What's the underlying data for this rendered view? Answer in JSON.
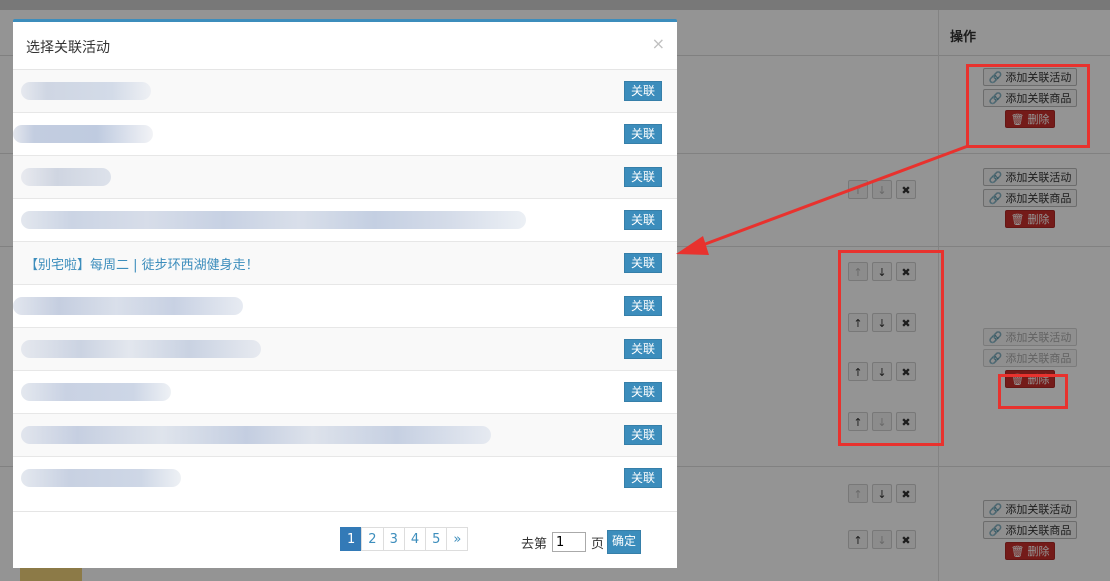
{
  "background": {
    "header": {
      "operation_label": "操作"
    },
    "rows": [
      {
        "actions": {
          "add_activity": "添加关联活动",
          "add_goods": "添加关联商品",
          "delete": "删除"
        }
      },
      {
        "actions": {
          "add_activity": "添加关联活动",
          "add_goods": "添加关联商品",
          "delete": "删除"
        }
      },
      {
        "actions": {
          "add_activity": "添加关联活动",
          "add_goods": "添加关联商品",
          "delete": "删除"
        }
      },
      {
        "actions": {
          "add_activity": "添加关联活动",
          "add_goods": "添加关联商品",
          "delete": "删除"
        }
      }
    ],
    "move_icons": {
      "up": "↑",
      "down": "↓",
      "remove": "✖"
    }
  },
  "modal": {
    "title": "选择关联活动",
    "close_icon": "×",
    "items": [
      {
        "text": "",
        "blurred": true,
        "button": "关联"
      },
      {
        "text": "",
        "blurred": true,
        "button": "关联"
      },
      {
        "text": "",
        "blurred": true,
        "button": "关联"
      },
      {
        "text": "",
        "blurred": true,
        "button": "关联"
      },
      {
        "text": "【别宅啦】每周二 | 徒步环西湖健身走！",
        "blurred": false,
        "button": "关联"
      },
      {
        "text": "",
        "blurred": true,
        "button": "关联"
      },
      {
        "text": "",
        "blurred": true,
        "button": "关联"
      },
      {
        "text": "",
        "blurred": true,
        "button": "关联"
      },
      {
        "text": "",
        "blurred": true,
        "button": "关联"
      },
      {
        "text": "",
        "blurred": true,
        "button": "关联"
      }
    ],
    "pagination": {
      "pages": [
        "1",
        "2",
        "3",
        "4",
        "5"
      ],
      "next": "»",
      "current_page": "1"
    },
    "goto": {
      "prefix": "去第",
      "value": "1",
      "suffix": "页",
      "confirm": "确定"
    }
  },
  "colors": {
    "primary": "#3c8dbc",
    "danger": "#c9302c",
    "annotation": "#e8322e"
  }
}
